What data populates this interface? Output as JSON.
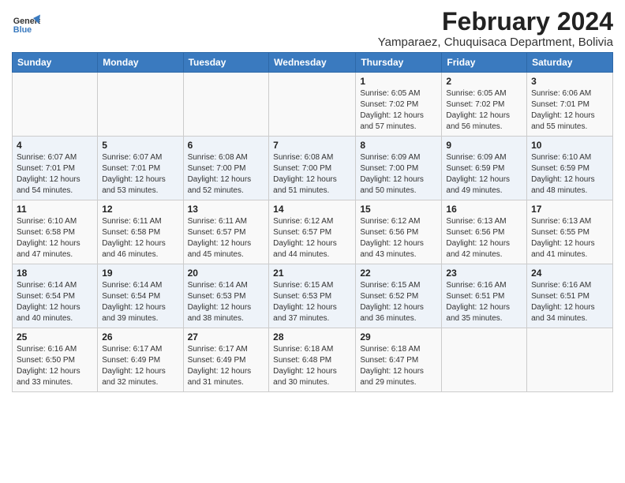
{
  "header": {
    "logo_line1": "General",
    "logo_line2": "Blue",
    "main_title": "February 2024",
    "subtitle": "Yamparaez, Chuquisaca Department, Bolivia"
  },
  "calendar": {
    "days_of_week": [
      "Sunday",
      "Monday",
      "Tuesday",
      "Wednesday",
      "Thursday",
      "Friday",
      "Saturday"
    ],
    "weeks": [
      [
        {
          "day": "",
          "info": ""
        },
        {
          "day": "",
          "info": ""
        },
        {
          "day": "",
          "info": ""
        },
        {
          "day": "",
          "info": ""
        },
        {
          "day": "1",
          "info": "Sunrise: 6:05 AM\nSunset: 7:02 PM\nDaylight: 12 hours\nand 57 minutes."
        },
        {
          "day": "2",
          "info": "Sunrise: 6:05 AM\nSunset: 7:02 PM\nDaylight: 12 hours\nand 56 minutes."
        },
        {
          "day": "3",
          "info": "Sunrise: 6:06 AM\nSunset: 7:01 PM\nDaylight: 12 hours\nand 55 minutes."
        }
      ],
      [
        {
          "day": "4",
          "info": "Sunrise: 6:07 AM\nSunset: 7:01 PM\nDaylight: 12 hours\nand 54 minutes."
        },
        {
          "day": "5",
          "info": "Sunrise: 6:07 AM\nSunset: 7:01 PM\nDaylight: 12 hours\nand 53 minutes."
        },
        {
          "day": "6",
          "info": "Sunrise: 6:08 AM\nSunset: 7:00 PM\nDaylight: 12 hours\nand 52 minutes."
        },
        {
          "day": "7",
          "info": "Sunrise: 6:08 AM\nSunset: 7:00 PM\nDaylight: 12 hours\nand 51 minutes."
        },
        {
          "day": "8",
          "info": "Sunrise: 6:09 AM\nSunset: 7:00 PM\nDaylight: 12 hours\nand 50 minutes."
        },
        {
          "day": "9",
          "info": "Sunrise: 6:09 AM\nSunset: 6:59 PM\nDaylight: 12 hours\nand 49 minutes."
        },
        {
          "day": "10",
          "info": "Sunrise: 6:10 AM\nSunset: 6:59 PM\nDaylight: 12 hours\nand 48 minutes."
        }
      ],
      [
        {
          "day": "11",
          "info": "Sunrise: 6:10 AM\nSunset: 6:58 PM\nDaylight: 12 hours\nand 47 minutes."
        },
        {
          "day": "12",
          "info": "Sunrise: 6:11 AM\nSunset: 6:58 PM\nDaylight: 12 hours\nand 46 minutes."
        },
        {
          "day": "13",
          "info": "Sunrise: 6:11 AM\nSunset: 6:57 PM\nDaylight: 12 hours\nand 45 minutes."
        },
        {
          "day": "14",
          "info": "Sunrise: 6:12 AM\nSunset: 6:57 PM\nDaylight: 12 hours\nand 44 minutes."
        },
        {
          "day": "15",
          "info": "Sunrise: 6:12 AM\nSunset: 6:56 PM\nDaylight: 12 hours\nand 43 minutes."
        },
        {
          "day": "16",
          "info": "Sunrise: 6:13 AM\nSunset: 6:56 PM\nDaylight: 12 hours\nand 42 minutes."
        },
        {
          "day": "17",
          "info": "Sunrise: 6:13 AM\nSunset: 6:55 PM\nDaylight: 12 hours\nand 41 minutes."
        }
      ],
      [
        {
          "day": "18",
          "info": "Sunrise: 6:14 AM\nSunset: 6:54 PM\nDaylight: 12 hours\nand 40 minutes."
        },
        {
          "day": "19",
          "info": "Sunrise: 6:14 AM\nSunset: 6:54 PM\nDaylight: 12 hours\nand 39 minutes."
        },
        {
          "day": "20",
          "info": "Sunrise: 6:14 AM\nSunset: 6:53 PM\nDaylight: 12 hours\nand 38 minutes."
        },
        {
          "day": "21",
          "info": "Sunrise: 6:15 AM\nSunset: 6:53 PM\nDaylight: 12 hours\nand 37 minutes."
        },
        {
          "day": "22",
          "info": "Sunrise: 6:15 AM\nSunset: 6:52 PM\nDaylight: 12 hours\nand 36 minutes."
        },
        {
          "day": "23",
          "info": "Sunrise: 6:16 AM\nSunset: 6:51 PM\nDaylight: 12 hours\nand 35 minutes."
        },
        {
          "day": "24",
          "info": "Sunrise: 6:16 AM\nSunset: 6:51 PM\nDaylight: 12 hours\nand 34 minutes."
        }
      ],
      [
        {
          "day": "25",
          "info": "Sunrise: 6:16 AM\nSunset: 6:50 PM\nDaylight: 12 hours\nand 33 minutes."
        },
        {
          "day": "26",
          "info": "Sunrise: 6:17 AM\nSunset: 6:49 PM\nDaylight: 12 hours\nand 32 minutes."
        },
        {
          "day": "27",
          "info": "Sunrise: 6:17 AM\nSunset: 6:49 PM\nDaylight: 12 hours\nand 31 minutes."
        },
        {
          "day": "28",
          "info": "Sunrise: 6:18 AM\nSunset: 6:48 PM\nDaylight: 12 hours\nand 30 minutes."
        },
        {
          "day": "29",
          "info": "Sunrise: 6:18 AM\nSunset: 6:47 PM\nDaylight: 12 hours\nand 29 minutes."
        },
        {
          "day": "",
          "info": ""
        },
        {
          "day": "",
          "info": ""
        }
      ]
    ]
  }
}
